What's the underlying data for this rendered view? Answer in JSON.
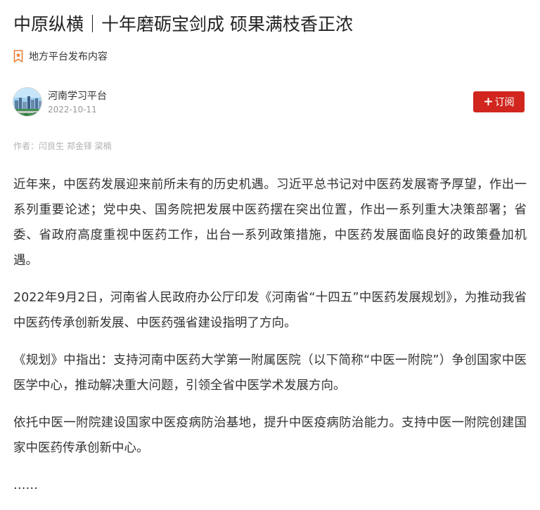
{
  "article": {
    "title": "中原纵横｜十年磨砺宝剑成 硕果满枝香正浓",
    "source_label": "地方平台发布内容",
    "channel": {
      "name": "河南学习平台",
      "date": "2022-10-11",
      "subscribe_label": "订阅",
      "subscribe_plus": "+"
    },
    "byline": {
      "prefix": "作者：",
      "authors": "闫良生 郑金铎 梁楠"
    },
    "paragraphs": [
      "近年来，中医药发展迎来前所未有的历史机遇。习近平总书记对中医药发展寄予厚望，作出一系列重要论述；党中央、国务院把发展中医药摆在突出位置，作出一系列重大决策部署；省委、省政府高度重视中医药工作，出台一系列政策措施，中医药发展面临良好的政策叠加机遇。",
      "2022年9月2日，河南省人民政府办公厅印发《河南省“十四五”中医药发展规划》，为推动我省中医药传承创新发展、中医药强省建设指明了方向。",
      "《规划》中指出：支持河南中医药大学第一附属医院（以下简称“中医一附院”）争创国家中医医学中心，推动解决重大问题，引领全省中医学术发展方向。",
      "依托中医一附院建设国家中医疫病防治基地，提升中医疫病防治能力。支持中医一附院创建国家中医药传承创新中心。",
      "……"
    ]
  },
  "icons": {
    "source": "badge-star-icon",
    "avatar": "city-skyline-avatar"
  },
  "colors": {
    "accent": "#d0261e",
    "source_icon": "#e8803a",
    "text": "#333333",
    "muted": "#999999"
  }
}
